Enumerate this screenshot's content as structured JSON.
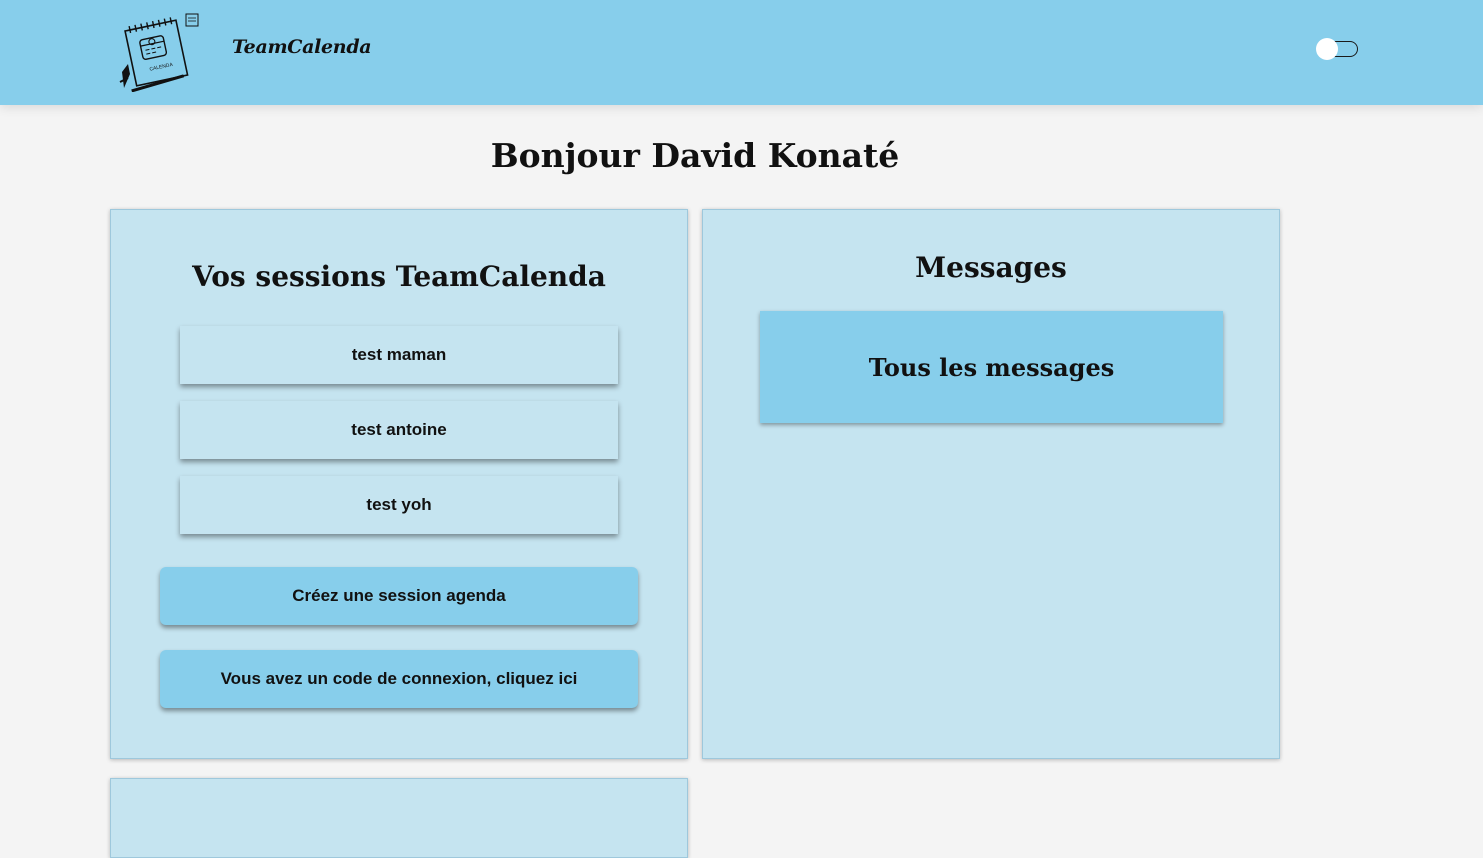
{
  "header": {
    "brand": "TeamCalenda",
    "logo_icon": "calendar-notebook-icon",
    "background": "#87ceeb",
    "theme_toggle": {
      "state": "off",
      "icon": "toggle-switch-icon"
    }
  },
  "main": {
    "greeting": "Bonjour David Konaté"
  },
  "sessions_panel": {
    "title": "Vos sessions TeamCalenda",
    "sessions": [
      {
        "label": "test maman"
      },
      {
        "label": "test antoine"
      },
      {
        "label": "test yoh"
      }
    ],
    "create_button": "Créez une session agenda",
    "code_button": "Vous avez un code de connexion, cliquez ici"
  },
  "messages_panel": {
    "title": "Messages",
    "all_messages_button": "Tous les messages"
  },
  "colors": {
    "page_background": "#f4f4f4",
    "panel_background": "#c5e4f0",
    "accent": "#87ceeb"
  }
}
